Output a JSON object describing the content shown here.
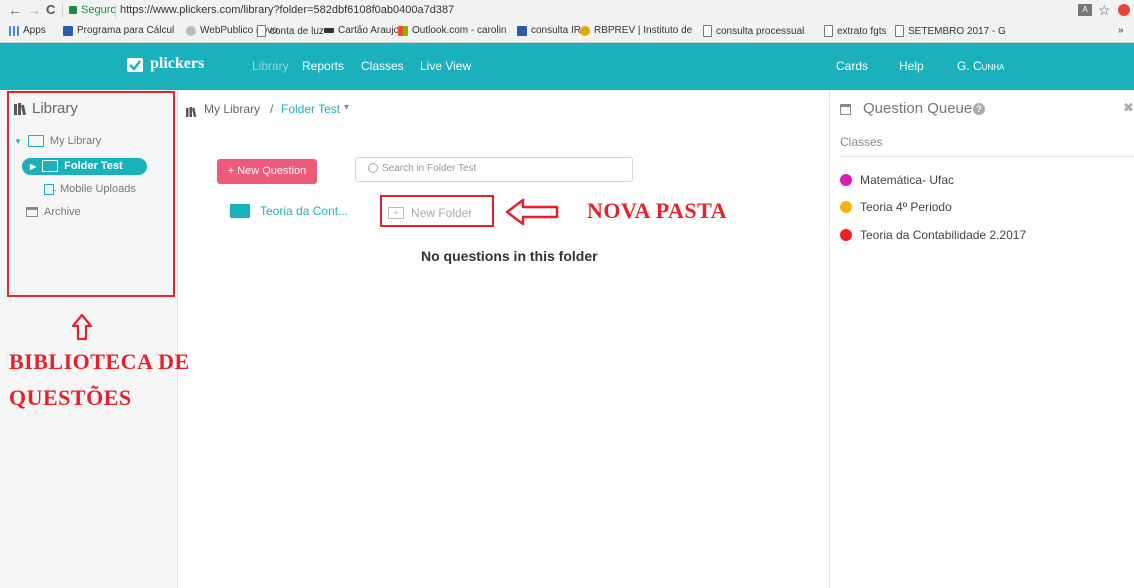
{
  "browser": {
    "back_glyph": "←",
    "forward_glyph": "→",
    "reload_glyph": "C",
    "secure_label": "Seguro",
    "url": "https://www.plickers.com/library?folder=582dbf6108f0ab0400a7d387",
    "star_glyph": "☆",
    "more_glyph": "»",
    "bookmarks": [
      "Apps",
      "Programa para Cálcul",
      "WebPublico novo",
      "conta de luz",
      "Cartão Araujo",
      "Outlook.com - carolin",
      "consulta IR",
      "RBPREV | Instituto de",
      "consulta processual",
      "extrato fgts",
      "SETEMBRO 2017 - G"
    ]
  },
  "header": {
    "logo": "plickers",
    "nav": [
      "Library",
      "Reports",
      "Classes",
      "Live View"
    ],
    "right": [
      "Cards",
      "Help",
      "G. Cunha"
    ]
  },
  "sidebar": {
    "title": "Library",
    "items": {
      "my_library": "My Library",
      "folder_test": "Folder Test",
      "mobile_uploads": "Mobile Uploads",
      "archive": "Archive"
    }
  },
  "main": {
    "breadcrumb_root": "My Library",
    "breadcrumb_sep": "/",
    "breadcrumb_current": "Folder Test",
    "new_question": "+ New Question",
    "search_placeholder": "Search in Folder Test",
    "folder_name": "Teoria da Cont...",
    "new_folder": "New Folder",
    "empty_message": "No questions in this folder"
  },
  "queue": {
    "title": "Question Queue",
    "close_glyph": "✖",
    "section": "Classes",
    "classes": [
      {
        "name": "Matemática- Ufac",
        "color": "#d91eb6"
      },
      {
        "name": "Teoria 4º Periodo",
        "color": "#f5b50f"
      },
      {
        "name": "Teoria da Contabilidade 2.2017",
        "color": "#ef2121"
      }
    ]
  },
  "annotations": {
    "nova_pasta": "NOVA PASTA",
    "biblioteca_line1": "BIBLIOTECA DE",
    "biblioteca_line2": "QUESTÕES",
    "arrow_up": "⇧",
    "annotation_color": "#e8202a"
  },
  "colors": {
    "brand": "#1ab1bd",
    "new_question_bg": "#ee5a7a"
  }
}
